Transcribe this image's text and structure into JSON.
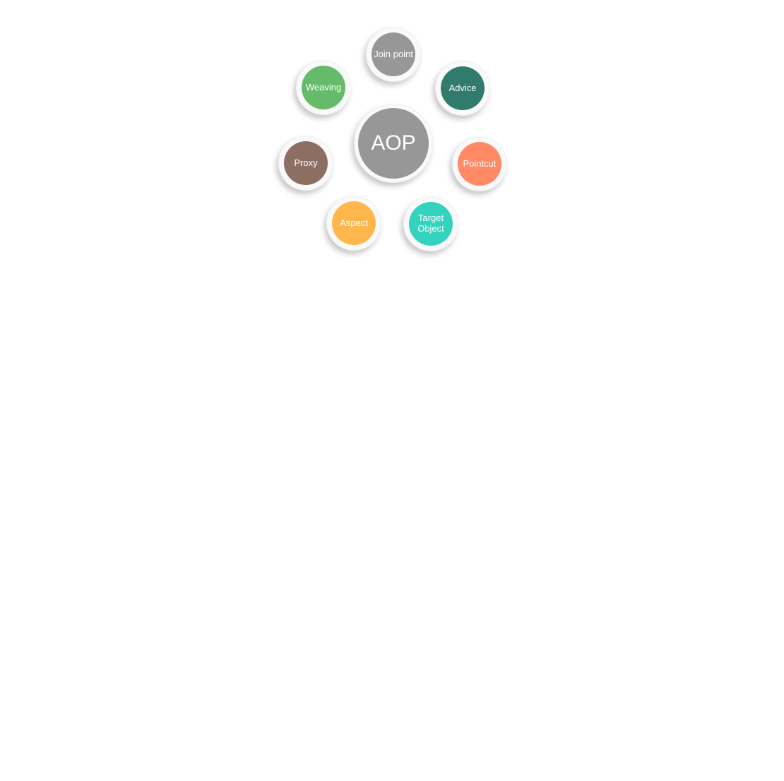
{
  "center": {
    "label": "AOP",
    "color": "#979797"
  },
  "nodes": [
    {
      "label": "Join point",
      "color": "#979797"
    },
    {
      "label": "Advice",
      "color": "#317a6e"
    },
    {
      "label": "Pointcut",
      "color": "#ff8a65"
    },
    {
      "label": "Target Object",
      "color": "#33d3c0"
    },
    {
      "label": "Aspect",
      "color": "#ffb74d"
    },
    {
      "label": "Proxy",
      "color": "#8d6e63"
    },
    {
      "label": "Weaving",
      "color": "#66bb6a"
    }
  ]
}
